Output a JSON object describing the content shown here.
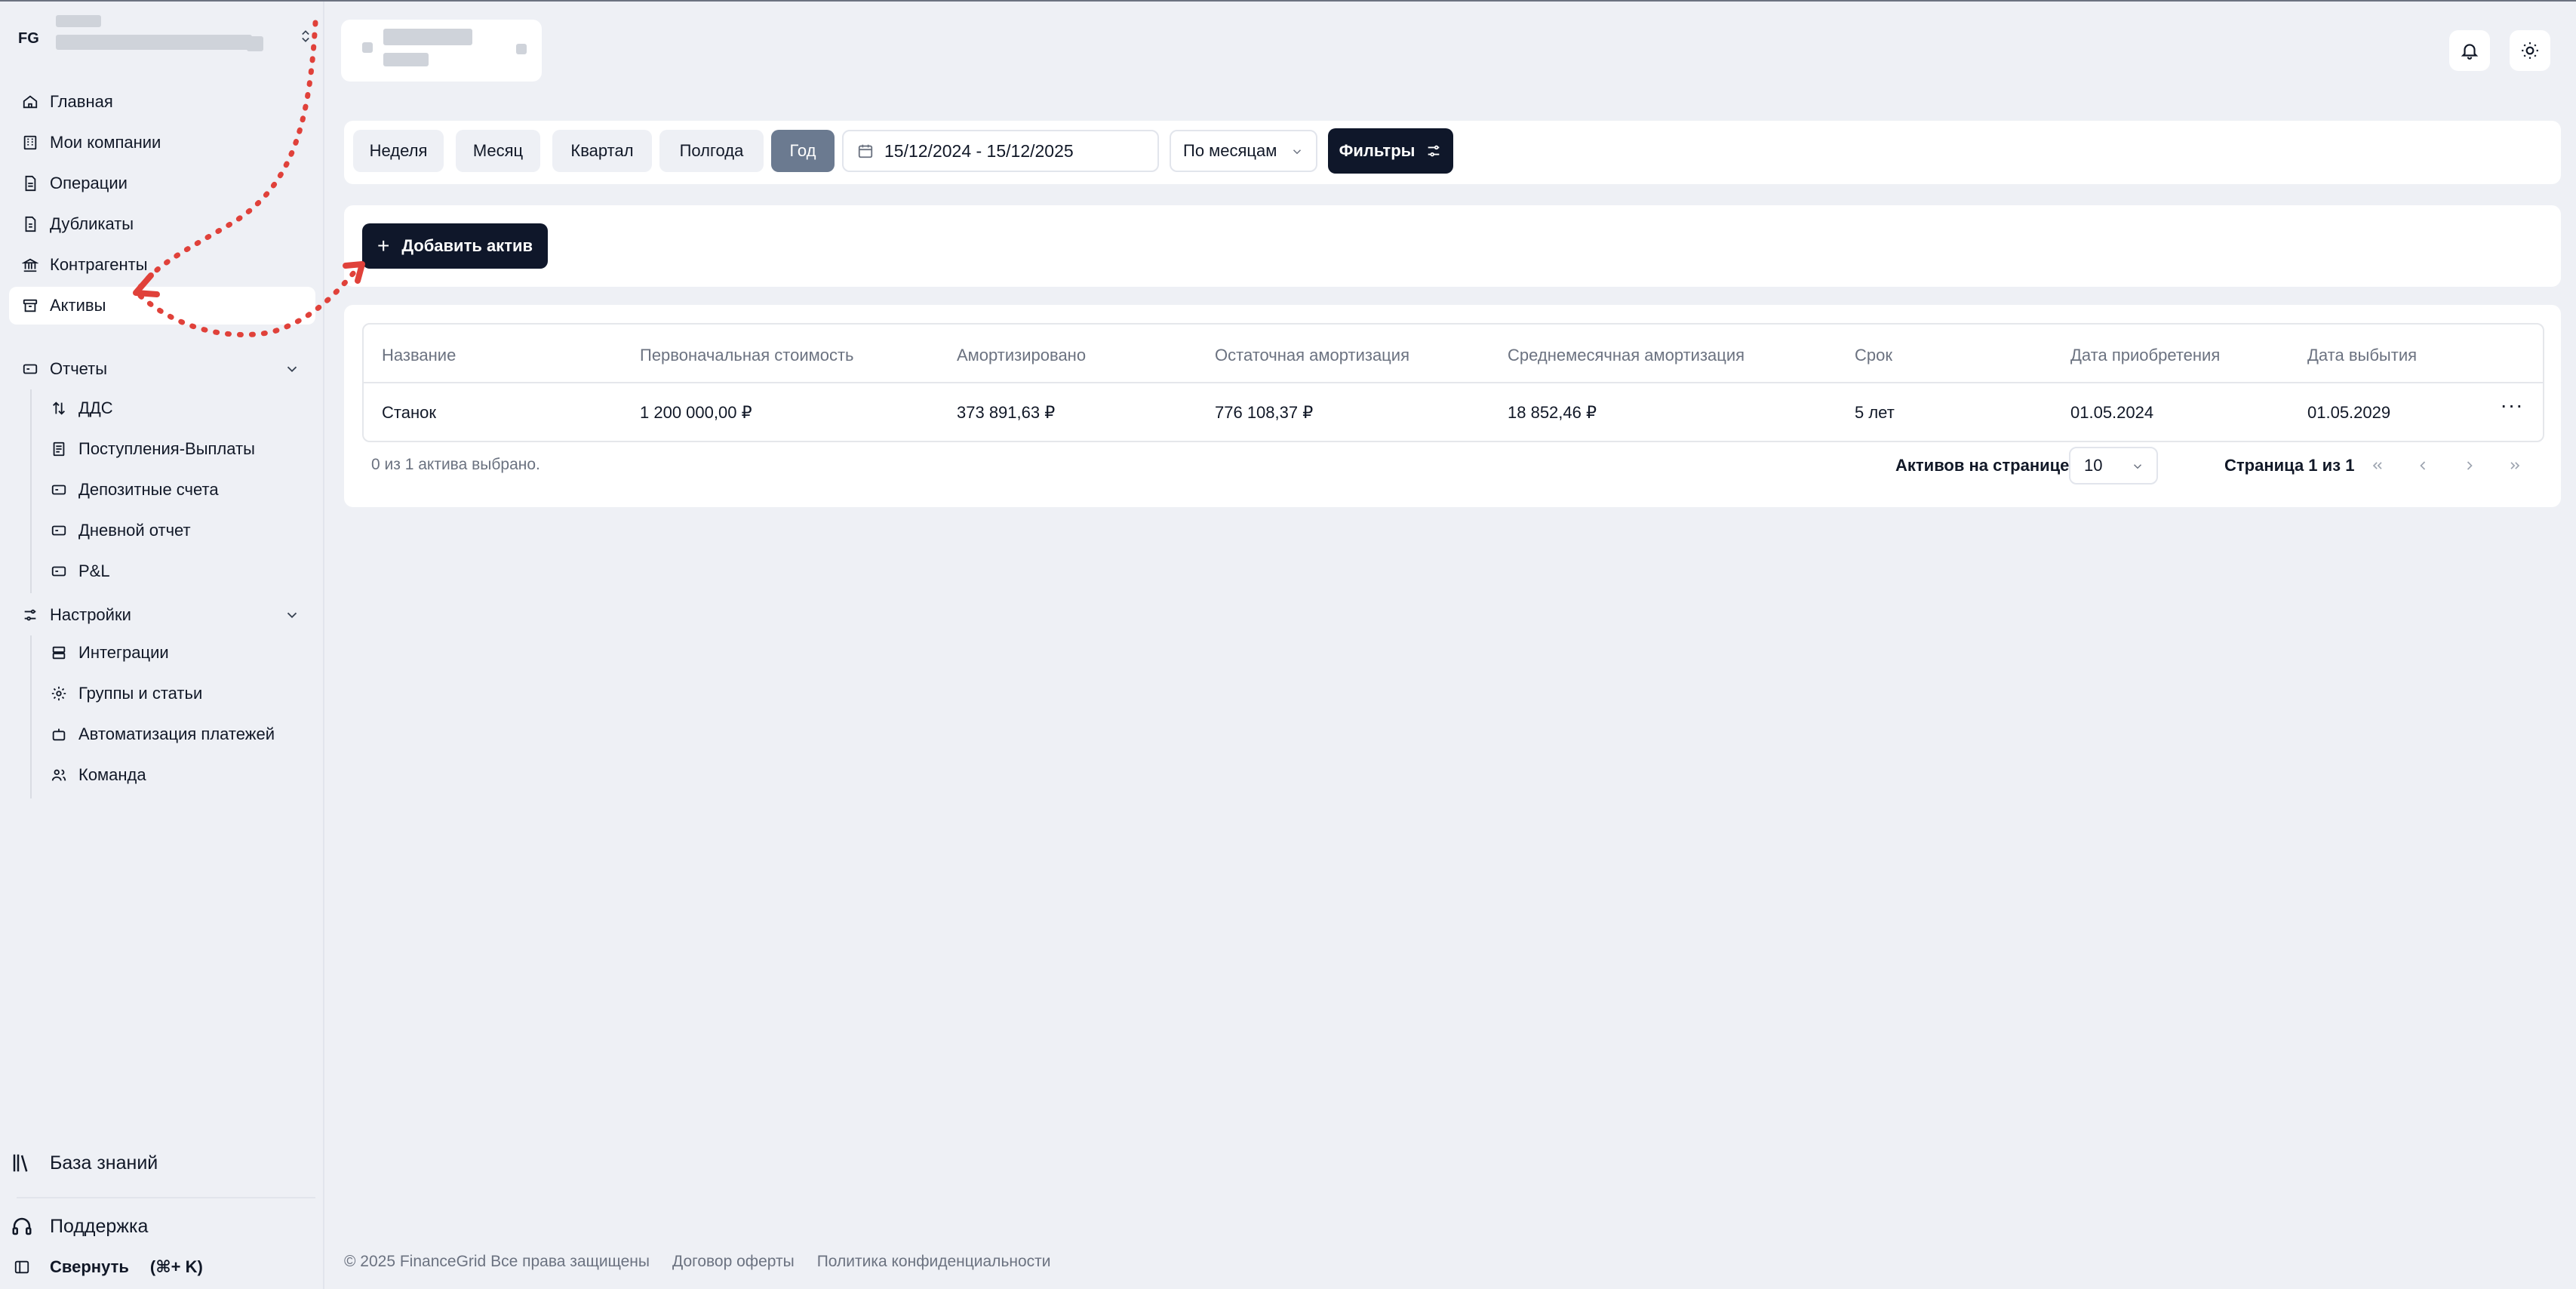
{
  "org": {
    "initials": "FG"
  },
  "sidebar": {
    "items": [
      {
        "label": "Главная",
        "icon": "home-icon"
      },
      {
        "label": "Мои компании",
        "icon": "building-icon"
      },
      {
        "label": "Операции",
        "icon": "document-icon"
      },
      {
        "label": "Дубликаты",
        "icon": "copy-document-icon"
      },
      {
        "label": "Контрагенты",
        "icon": "bank-icon"
      },
      {
        "label": "Активы",
        "icon": "archive-icon",
        "active": true
      }
    ],
    "reports": {
      "label": "Отчеты",
      "icon": "report-icon",
      "children": [
        {
          "label": "ДДС",
          "icon": "arrows-updown-icon"
        },
        {
          "label": "Поступления-Выплаты",
          "icon": "receipt-icon"
        },
        {
          "label": "Депозитные счета",
          "icon": "card-icon"
        },
        {
          "label": "Дневной отчет",
          "icon": "card-icon"
        },
        {
          "label": "P&L",
          "icon": "card-icon"
        }
      ]
    },
    "settings": {
      "label": "Настройки",
      "icon": "sliders-icon",
      "children": [
        {
          "label": "Интеграции",
          "icon": "server-icon"
        },
        {
          "label": "Группы и статьи",
          "icon": "gear-icon"
        },
        {
          "label": "Автоматизация платежей",
          "icon": "robot-icon"
        },
        {
          "label": "Команда",
          "icon": "users-icon"
        }
      ]
    },
    "knowledge_base": "База знаний",
    "support": "Поддержка",
    "collapse": "Свернуть",
    "collapse_shortcut": "(⌘+ K)"
  },
  "filters": {
    "periods": [
      "Неделя",
      "Месяц",
      "Квартал",
      "Полгода",
      "Год"
    ],
    "active_period": "Год",
    "date_range": "15/12/2024 - 15/12/2025",
    "grouping": "По месяцам",
    "filters_label": "Фильтры"
  },
  "actions": {
    "add_asset": "Добавить актив"
  },
  "table": {
    "columns": [
      "Название",
      "Первоначальная стоимость",
      "Амортизировано",
      "Остаточная амортизация",
      "Среднемесячная амортизация",
      "Срок",
      "Дата приобретения",
      "Дата выбытия"
    ],
    "rows": [
      [
        "Станок",
        "1 200 000,00 ₽",
        "373 891,63 ₽",
        "776 108,37 ₽",
        "18 852,46 ₽",
        "5 лет",
        "01.05.2024",
        "01.05.2029"
      ]
    ],
    "more_label": "···"
  },
  "pagination": {
    "selected_info": "0 из 1 актива выбрано.",
    "per_page_label": "Активов на странице",
    "per_page_value": "10",
    "page_info": "Страница 1 из 1"
  },
  "footer": {
    "copyright": "© 2025 FinanceGrid Все права защищены",
    "offer": "Договор оферты",
    "privacy": "Политика конфиденциальности"
  },
  "colors": {
    "background": "#eef0f5",
    "primary_button": "#0f172a",
    "active_period": "#6b7a90",
    "annotation": "#e0413a"
  }
}
